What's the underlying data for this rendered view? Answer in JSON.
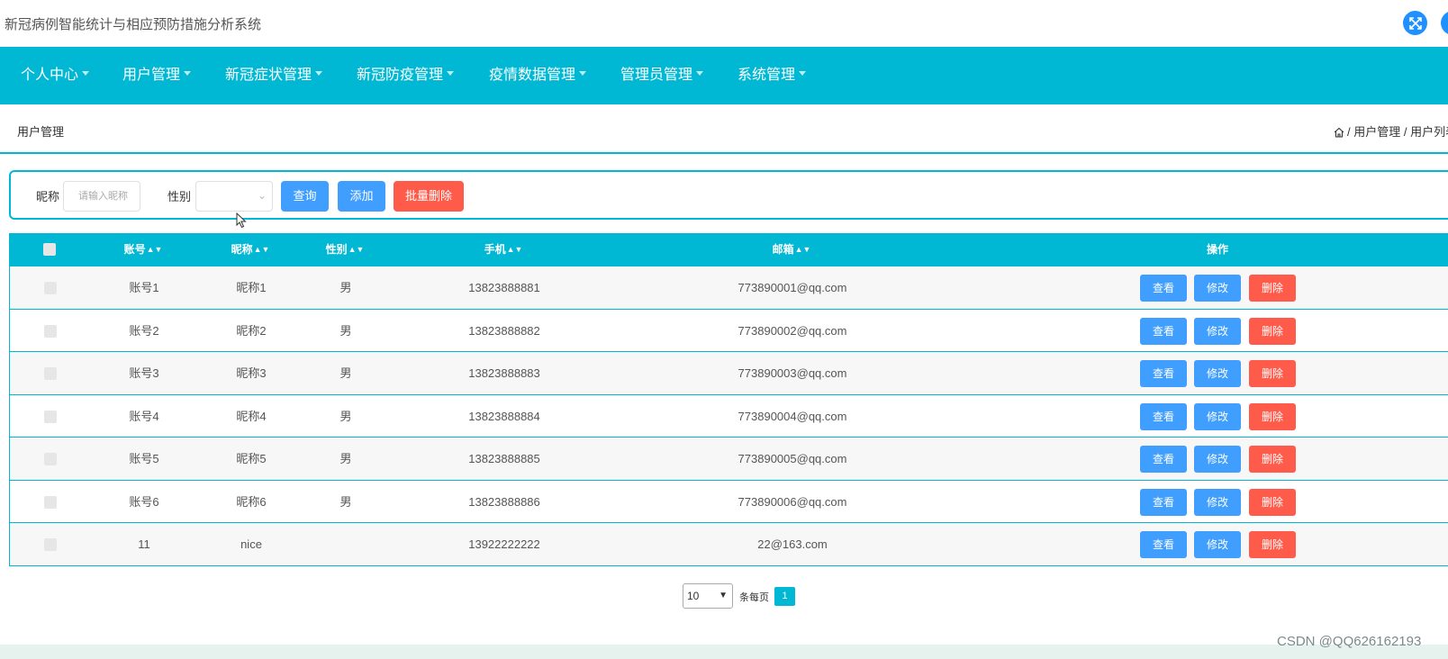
{
  "app": {
    "title": "新冠病例智能统计与相应预防措施分析系统"
  },
  "nav": {
    "items": [
      {
        "label": "个人中心"
      },
      {
        "label": "用户管理"
      },
      {
        "label": "新冠症状管理"
      },
      {
        "label": "新冠防疫管理"
      },
      {
        "label": "疫情数据管理"
      },
      {
        "label": "管理员管理"
      },
      {
        "label": "系统管理"
      }
    ]
  },
  "breadcrumb": {
    "title": "用户管理",
    "path1": "用户管理",
    "path2": "用户列表",
    "separator": "/"
  },
  "search": {
    "nickname_label": "昵称",
    "nickname_placeholder": "请输入昵称",
    "nickname_value": "",
    "gender_label": "性别",
    "gender_value": "",
    "query_label": "查询",
    "add_label": "添加",
    "batch_delete_label": "批量删除"
  },
  "table": {
    "columns": {
      "account": "账号",
      "nickname": "昵称",
      "gender": "性别",
      "phone": "手机",
      "email": "邮箱",
      "actions": "操作"
    },
    "action_labels": {
      "view": "查看",
      "edit": "修改",
      "delete": "删除"
    },
    "rows": [
      {
        "account": "账号1",
        "nickname": "昵称1",
        "gender": "男",
        "phone": "13823888881",
        "email": "773890001@qq.com"
      },
      {
        "account": "账号2",
        "nickname": "昵称2",
        "gender": "男",
        "phone": "13823888882",
        "email": "773890002@qq.com"
      },
      {
        "account": "账号3",
        "nickname": "昵称3",
        "gender": "男",
        "phone": "13823888883",
        "email": "773890003@qq.com"
      },
      {
        "account": "账号4",
        "nickname": "昵称4",
        "gender": "男",
        "phone": "13823888884",
        "email": "773890004@qq.com"
      },
      {
        "account": "账号5",
        "nickname": "昵称5",
        "gender": "男",
        "phone": "13823888885",
        "email": "773890005@qq.com"
      },
      {
        "account": "账号6",
        "nickname": "昵称6",
        "gender": "男",
        "phone": "13823888886",
        "email": "773890006@qq.com"
      },
      {
        "account": "11",
        "nickname": "nice",
        "gender": "",
        "phone": "13922222222",
        "email": "22@163.com"
      }
    ]
  },
  "pagination": {
    "page_size": "10",
    "per_page_label": "条每页",
    "current_page": "1"
  },
  "watermark": "CSDN @QQ626162193",
  "colors": {
    "nav": "#00b8d4",
    "primary": "#409eff",
    "danger": "#ff5b4b",
    "view": "#409eff",
    "edit": "#409eff"
  },
  "icons": {
    "fullscreen": "expand-icon",
    "home": "home-icon",
    "sort": "sort-icon",
    "cursor": "mouse-cursor-icon"
  }
}
